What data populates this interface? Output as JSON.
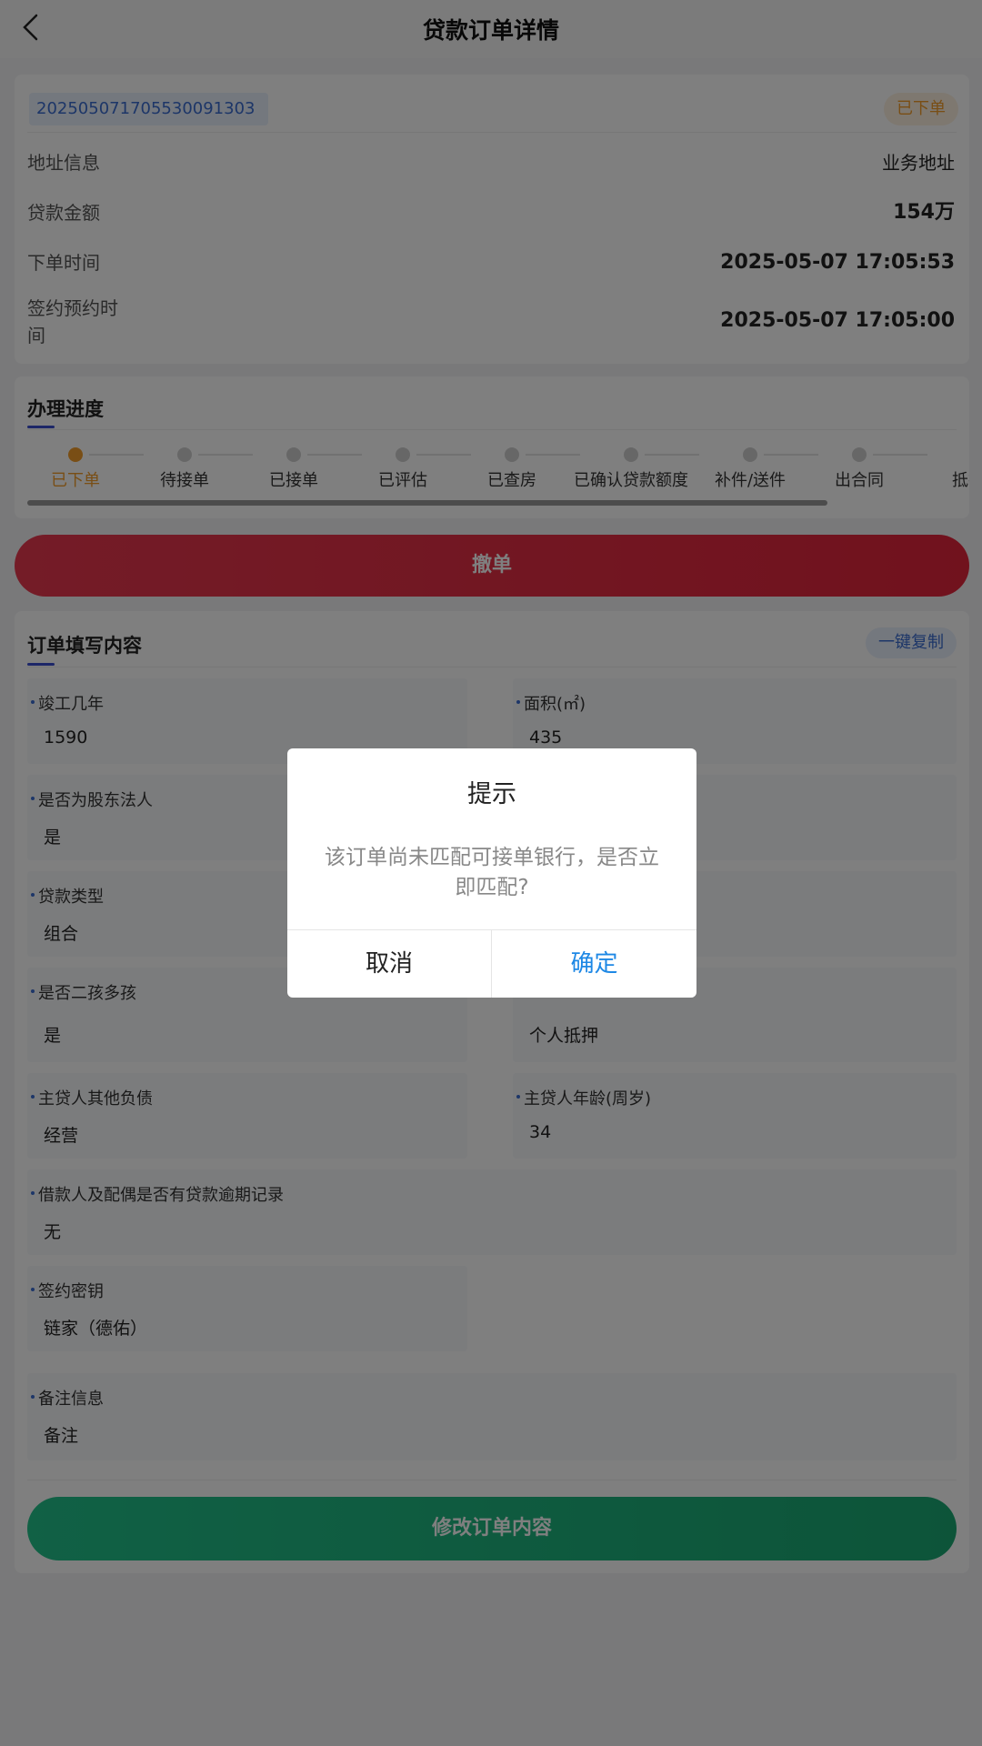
{
  "header": {
    "title": "贷款订单详情",
    "back_icon": "chevron-left-icon"
  },
  "order": {
    "number": "20250507170553009130​3",
    "status": "已下单",
    "rows": [
      {
        "label": "地址信息",
        "value": "业务地址"
      },
      {
        "label": "贷款金额",
        "value": "154万"
      },
      {
        "label": "下单时间",
        "value": "2025-05-07 17:05:53"
      },
      {
        "label": "签约预约时间",
        "value": "2025-05-07 17:05:00"
      }
    ]
  },
  "progress": {
    "title": "办理进度",
    "steps": [
      "已下单",
      "待接单",
      "已接单",
      "已评估",
      "已查房",
      "已确认贷款额度",
      "补件/送件",
      "出合同",
      "抵押"
    ],
    "active_index": 0
  },
  "actions": {
    "cancel_order": "撤单",
    "edit_order": "修改订单内容"
  },
  "content": {
    "title": "订单填写内容",
    "copy_button": "一键复制",
    "fields": [
      {
        "label": "竣工几年",
        "value": "1590"
      },
      {
        "label": "面积(㎡)",
        "value": "435"
      },
      {
        "label": "是否为股东法人",
        "value": "是"
      },
      {
        "label": "",
        "value": ""
      },
      {
        "label": "贷款类型",
        "value": "组合"
      },
      {
        "label": "",
        "value": ""
      },
      {
        "label": "是否二孩多孩",
        "value": "是"
      },
      {
        "label": "",
        "value": "个人抵押"
      },
      {
        "label": "主贷人其他负债",
        "value": "经营"
      },
      {
        "label": "主贷人年龄(周岁)",
        "value": "34"
      },
      {
        "label": "借款人及配偶是否有贷款逾期记录",
        "value": "无"
      },
      {
        "label": "签约密钥",
        "value": "链家（德佑）"
      },
      {
        "label": "备注信息",
        "value": "备注"
      }
    ]
  },
  "dialog": {
    "title": "提示",
    "message": "该订单尚未匹配可接单银行，是否立即匹配?",
    "cancel": "取消",
    "confirm": "确定"
  },
  "colors": {
    "accent_blue": "#3a6cd1",
    "status_orange": "#f29d2a",
    "danger_red": "#e2243b",
    "success_green": "#1aa973",
    "confirm_blue": "#1e88e5"
  }
}
